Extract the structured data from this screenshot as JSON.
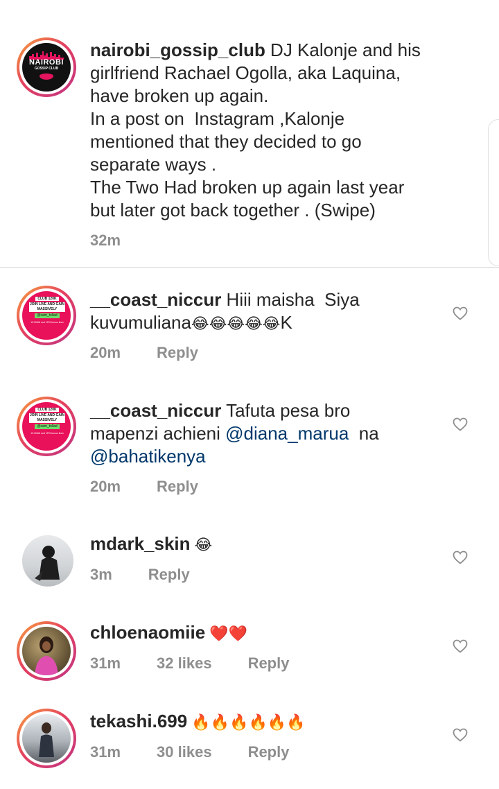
{
  "caption": {
    "username": "nairobi_gossip_club",
    "text": " DJ Kalonje and his\ngirlfriend Rachael Ogolla, aka Laquina,\nhave broken up again.\nIn a post on  Instagram ,Kalonje\nmentioned that they decided to go\nseparate ways .\nThe Two Had broken up again last year\nbut later got back together . (Swipe)",
    "time": "32m",
    "logo_line1": "NAIROBI",
    "logo_line2": "GOSSIP CLUB"
  },
  "club_logo": {
    "line1": "CLUB 120K",
    "line2": "JOIN LIVE AND GAIN MASSIVELY",
    "line3": "@sam_tollad",
    "line4": "10:20AM and 1PM bonus lives"
  },
  "comments": [
    {
      "username": "__coast_niccur",
      "text": " Hiii maisha  Siya\nkuvumuliana",
      "emojis": "😂😂😂😂😂",
      "after": "K",
      "time": "20m",
      "reply": "Reply"
    },
    {
      "username": "__coast_niccur",
      "text": " Tafuta pesa bro\nmapenzi achieni ",
      "mention1": "@diana_marua",
      "mid": "  na\n",
      "mention2": "@bahatikenya",
      "time": "20m",
      "reply": "Reply"
    },
    {
      "username": "mdark_skin",
      "emojis": " 😂",
      "time": "3m",
      "reply": "Reply"
    },
    {
      "username": "chloenaomiie",
      "emojis": " ❤️❤️",
      "time": "31m",
      "likes": "32 likes",
      "reply": "Reply"
    },
    {
      "username": "tekashi.699",
      "emojis": " 🔥🔥🔥🔥🔥🔥",
      "time": "31m",
      "likes": "30 likes",
      "reply": "Reply"
    }
  ],
  "icons": {
    "heart": "heart-outline-icon"
  },
  "colors": {
    "mention": "#00376b",
    "meta": "#8e8e8e",
    "club_pink": "#e8115a"
  }
}
